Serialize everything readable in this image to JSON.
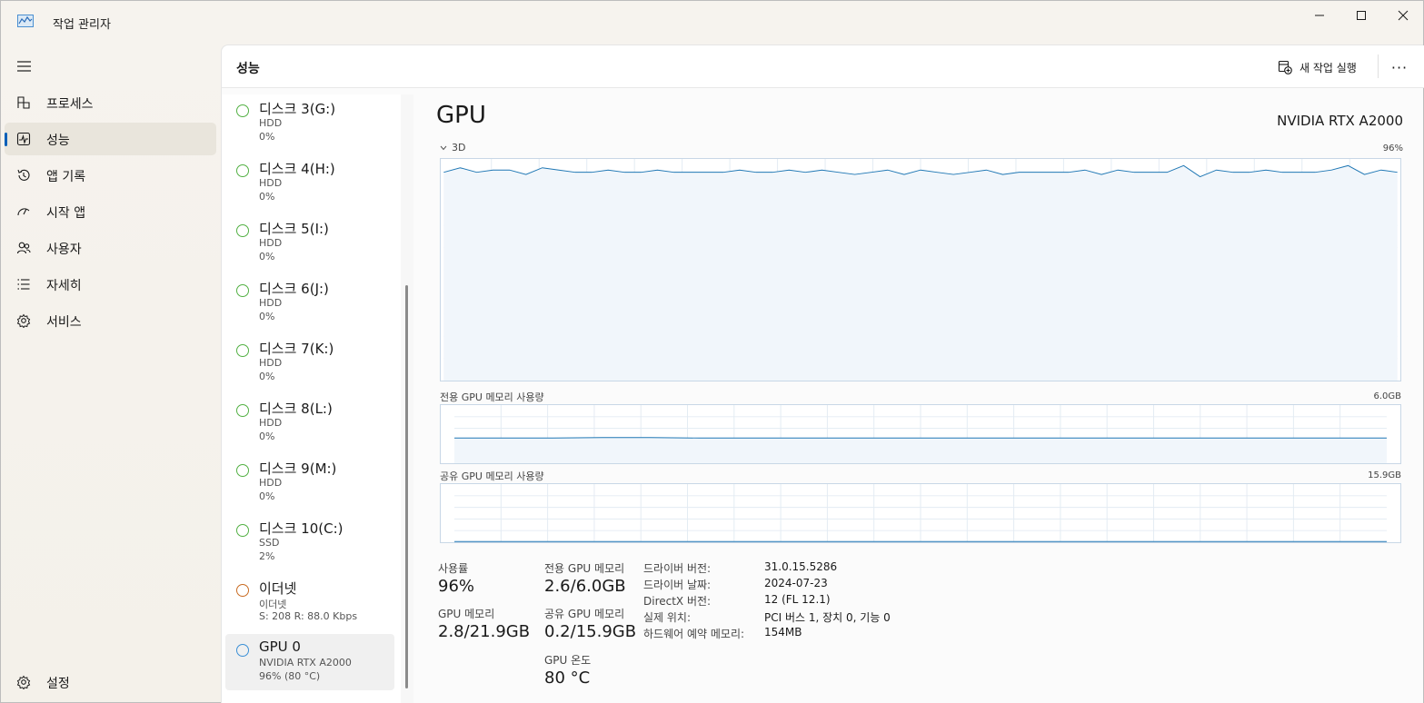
{
  "window": {
    "title": "작업 관리자"
  },
  "sidebar": {
    "items": [
      {
        "label": "프로세스",
        "icon": "processes-icon"
      },
      {
        "label": "성능",
        "icon": "performance-icon",
        "active": true
      },
      {
        "label": "앱 기록",
        "icon": "history-icon"
      },
      {
        "label": "시작 앱",
        "icon": "startup-icon"
      },
      {
        "label": "사용자",
        "icon": "users-icon"
      },
      {
        "label": "자세히",
        "icon": "details-icon"
      },
      {
        "label": "서비스",
        "icon": "services-icon"
      }
    ],
    "settings_label": "설정"
  },
  "header": {
    "title": "성능",
    "new_task_label": "새 작업 실행",
    "more_label": "···"
  },
  "devices": [
    {
      "name": "디스크 3(G:)",
      "type": "HDD",
      "value": "0%",
      "status": "green"
    },
    {
      "name": "디스크 4(H:)",
      "type": "HDD",
      "value": "0%",
      "status": "green"
    },
    {
      "name": "디스크 5(I:)",
      "type": "HDD",
      "value": "0%",
      "status": "green"
    },
    {
      "name": "디스크 6(J:)",
      "type": "HDD",
      "value": "0%",
      "status": "green"
    },
    {
      "name": "디스크 7(K:)",
      "type": "HDD",
      "value": "0%",
      "status": "green"
    },
    {
      "name": "디스크 8(L:)",
      "type": "HDD",
      "value": "0%",
      "status": "green"
    },
    {
      "name": "디스크 9(M:)",
      "type": "HDD",
      "value": "0%",
      "status": "green"
    },
    {
      "name": "디스크 10(C:)",
      "type": "SSD",
      "value": "2%",
      "status": "green"
    },
    {
      "name": "이더넷",
      "type": "이더넷",
      "value": "S: 208 R: 88.0 Kbps",
      "status": "orange"
    },
    {
      "name": "GPU 0",
      "type": "NVIDIA RTX A2000",
      "value": "96% (80 °C)",
      "status": "blue",
      "selected": true
    }
  ],
  "detail": {
    "title": "GPU",
    "model": "NVIDIA RTX A2000",
    "graph_3d": {
      "label": "3D",
      "max": "96%"
    },
    "graph_dedicated": {
      "label": "전용 GPU 메모리 사용량",
      "max": "6.0GB"
    },
    "graph_shared": {
      "label": "공유 GPU 메모리 사용량",
      "max": "15.9GB"
    },
    "stats": {
      "utilization_label": "사용률",
      "utilization_value": "96%",
      "dedicated_label": "전용 GPU 메모리",
      "dedicated_value": "2.6/6.0GB",
      "gpu_memory_label": "GPU 메모리",
      "gpu_memory_value": "2.8/21.9GB",
      "shared_label": "공유 GPU 메모리",
      "shared_value": "0.2/15.9GB",
      "temp_label": "GPU 온도",
      "temp_value": "80 °C"
    },
    "info": [
      {
        "key": "드라이버 버전:",
        "value": "31.0.15.5286"
      },
      {
        "key": "드라이버 날짜:",
        "value": "2024-07-23"
      },
      {
        "key": "DirectX 버전:",
        "value": "12 (FL 12.1)"
      },
      {
        "key": "실제 위치:",
        "value": "PCI 버스 1, 장치 0, 기능 0"
      },
      {
        "key": "하드웨어 예약 메모리:",
        "value": "154MB"
      }
    ]
  },
  "chart_data": [
    {
      "type": "area",
      "title": "3D",
      "ylim": [
        0,
        100
      ],
      "series": [
        {
          "values": [
            94,
            96,
            94,
            95,
            95,
            93,
            96,
            95,
            94,
            94,
            95,
            94,
            94,
            95,
            94,
            94,
            94,
            94,
            95,
            94,
            94,
            95,
            94,
            95,
            94,
            93,
            94,
            95,
            93,
            95,
            94,
            93,
            94,
            95,
            93,
            94,
            94,
            94,
            94,
            95,
            93,
            95,
            94,
            94,
            94,
            97,
            92,
            95,
            94,
            94,
            95,
            94,
            94,
            94,
            95,
            97,
            93,
            95,
            94
          ]
        }
      ]
    },
    {
      "type": "area",
      "title": "전용 GPU 메모리 사용량",
      "ylim": [
        0,
        6.0
      ],
      "series": [
        {
          "values": [
            2.6,
            2.6,
            2.6,
            2.65,
            2.65,
            2.6,
            2.6,
            2.6,
            2.6,
            2.6,
            2.6,
            2.6,
            2.6,
            2.6,
            2.6,
            2.6,
            2.6,
            2.6,
            2.6,
            2.6
          ]
        }
      ]
    },
    {
      "type": "area",
      "title": "공유 GPU 메모리 사용량",
      "ylim": [
        0,
        15.9
      ],
      "series": [
        {
          "values": [
            0.2,
            0.2,
            0.2,
            0.2,
            0.2,
            0.2,
            0.2,
            0.2,
            0.2,
            0.2
          ]
        }
      ]
    }
  ]
}
